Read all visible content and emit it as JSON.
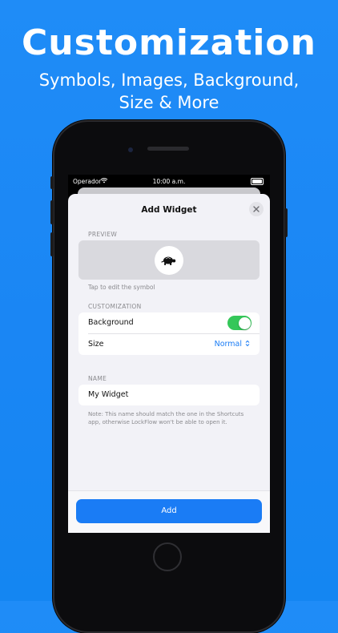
{
  "promo": {
    "headline": "Customization",
    "subline_1": "Symbols, Images, Background,",
    "subline_2": "Size & More"
  },
  "status_bar": {
    "carrier": "Operador",
    "time": "10:00 a.m."
  },
  "sheet": {
    "title": "Add Widget",
    "preview_label": "PREVIEW",
    "preview_hint": "Tap to edit the symbol",
    "customization_label": "CUSTOMIZATION",
    "background_label": "Background",
    "background_enabled": true,
    "size_label": "Size",
    "size_value": "Normal",
    "name_label": "NAME",
    "name_value": "My Widget",
    "note": "Note: This name should match the one in the Shortcuts app, otherwise LockFlow won't be able to open it.",
    "add_label": "Add"
  },
  "colors": {
    "background_blue": "#1f8cf7",
    "accent_blue": "#1a7cf5",
    "toggle_green": "#34c759"
  },
  "icons": {
    "preview_symbol": "turtle-icon",
    "close": "close-icon",
    "size_selector": "chevron-up-down-icon",
    "wifi": "wifi-icon",
    "battery": "battery-icon"
  }
}
